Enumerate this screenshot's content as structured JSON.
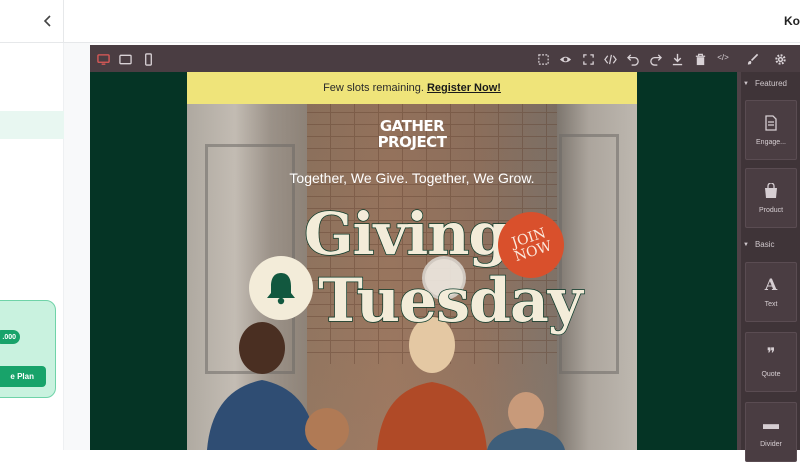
{
  "header": {
    "back_icon": "chevron-left-icon",
    "user_name": "Kol"
  },
  "sidebar": {
    "plan_price": ".000",
    "plan_button": "e Plan"
  },
  "toolbar": {
    "icons": [
      "desktop-view-icon",
      "tablet-view-icon",
      "mobile-view-icon",
      "select-outline-icon",
      "preview-eye-icon",
      "fullscreen-icon",
      "code-view-icon",
      "undo-icon",
      "redo-icon",
      "download-icon",
      "delete-icon",
      "html-code-icon",
      "style-brush-icon",
      "settings-gear-icon"
    ],
    "code_label": "</>"
  },
  "blocks_panel": {
    "featured_title": "Featured",
    "basic_title": "Basic",
    "featured": [
      {
        "label": "Engage...",
        "icon": "document-icon"
      },
      {
        "label": "Product",
        "icon": "shopping-bag-icon"
      }
    ],
    "basic": [
      {
        "label": "Text",
        "icon": "text-A-icon",
        "glyph": "A"
      },
      {
        "label": "Quote",
        "icon": "quote-icon",
        "glyph": "❞"
      },
      {
        "label": "Divider",
        "icon": "divider-icon",
        "glyph": "▬"
      }
    ]
  },
  "email": {
    "banner_text": "Few slots remaining.",
    "banner_link": "Register Now!",
    "logo_line1": "GATHER",
    "logo_line2": "PROJECT",
    "tagline": "Together, We Give. Together, We Grow.",
    "title_line1": "Giving",
    "title_line2": "Tuesday",
    "badge_line1": "JOIN",
    "badge_line2": "NOW"
  },
  "colors": {
    "editor_bg": "#053425",
    "toolbar_bg": "#4a3d42",
    "banner_bg": "#efe47a",
    "badge": "#d9502c",
    "accent_green": "#18a36a"
  }
}
